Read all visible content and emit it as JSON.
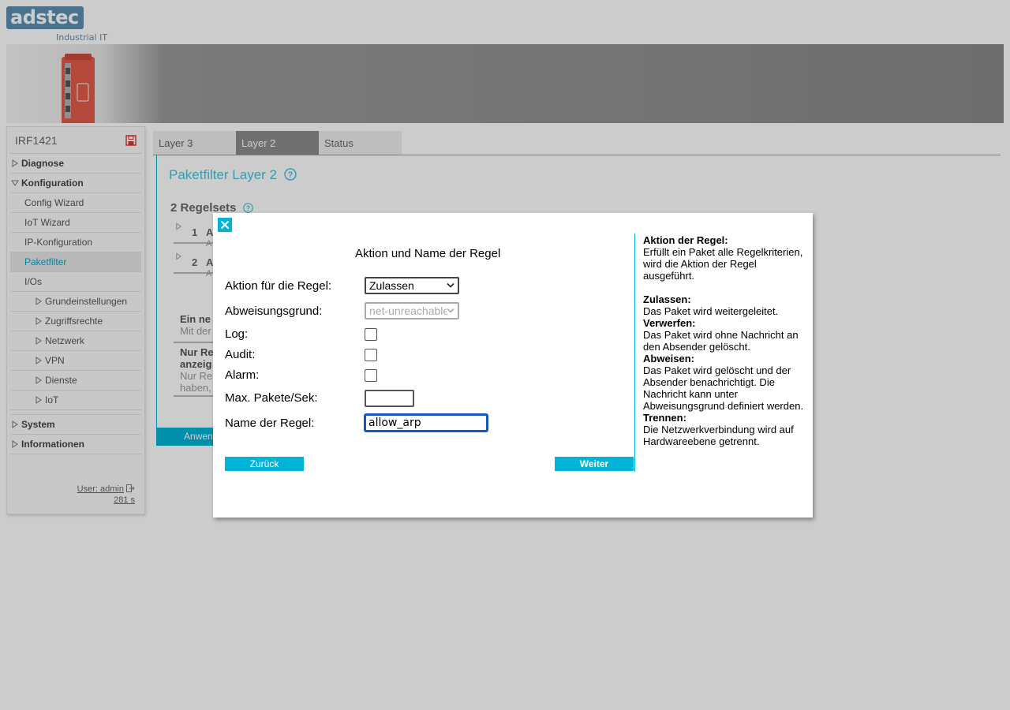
{
  "logo": {
    "brand": "adstec",
    "tagline": "Industrial IT"
  },
  "sidebar": {
    "device_name": "IRF1421",
    "items": [
      {
        "label": "Diagnose",
        "level": "top",
        "expanded": false
      },
      {
        "label": "Konfiguration",
        "level": "top",
        "expanded": true
      },
      {
        "label": "Config Wizard",
        "level": "sub"
      },
      {
        "label": "IoT Wizard",
        "level": "sub"
      },
      {
        "label": "IP-Konfiguration",
        "level": "sub"
      },
      {
        "label": "Paketfilter",
        "level": "sub",
        "active": true
      },
      {
        "label": "I/Os",
        "level": "sub"
      },
      {
        "label": "Grundeinstellungen",
        "level": "subsub"
      },
      {
        "label": "Zugriffsrechte",
        "level": "subsub"
      },
      {
        "label": "Netzwerk",
        "level": "subsub"
      },
      {
        "label": "VPN",
        "level": "subsub"
      },
      {
        "label": "Dienste",
        "level": "subsub"
      },
      {
        "label": "IoT",
        "level": "subsub"
      },
      {
        "label": "System",
        "level": "top",
        "expanded": false
      },
      {
        "label": "Informationen",
        "level": "top",
        "expanded": false
      }
    ],
    "user_label": "User: admin",
    "session_timer": "281 s"
  },
  "tabs": [
    {
      "label": "Layer 3",
      "active": false
    },
    {
      "label": "Layer 2",
      "active": true
    },
    {
      "label": "Status",
      "active": false
    }
  ],
  "page": {
    "title": "Paketfilter Layer 2",
    "rulesets_title": "2 Regelsets",
    "rulesets": [
      {
        "num": "1",
        "letter": "A",
        "sub": "A"
      },
      {
        "num": "2",
        "letter": "A",
        "sub": "A"
      }
    ],
    "info1_bold": "Ein ne",
    "info1_text": "Mit der",
    "info2_bold_1": "Nur Re",
    "info2_bold_2": "anzeig",
    "info2_text_1": "Nur Re",
    "info2_text_2": "haben,",
    "apply_label": "Anwen"
  },
  "dialog": {
    "heading": "Aktion und Name der Regel",
    "action_label": "Aktion für die Regel:",
    "action_value": "Zulassen",
    "reject_reason_label": "Abweisungsgrund:",
    "reject_reason_value": "net-unreachable",
    "log_label": "Log:",
    "audit_label": "Audit:",
    "alarm_label": "Alarm:",
    "max_packets_label": "Max. Pakete/Sek:",
    "max_packets_value": "",
    "rule_name_label": "Name der Regel:",
    "rule_name_value": "allow_arp",
    "back_label": "Zurück",
    "next_label": "Weiter"
  },
  "help": {
    "title": "Aktion der Regel:",
    "intro": "Erfüllt ein Paket alle Regelkriterien, wird die Aktion der Regel ausgeführt.",
    "allow_title": "Zulassen:",
    "allow_text": "Das Paket wird weitergeleitet.",
    "drop_title": "Verwerfen:",
    "drop_text": "Das Paket wird ohne Nachricht an den Absender gelöscht.",
    "reject_title": "Abweisen:",
    "reject_text": "Das Paket wird gelöscht und der Absender benachrichtigt. Die Nachricht kann unter Abweisungsgrund definiert werden.",
    "disconnect_title": "Trennen:",
    "disconnect_text": "Die Netzwerkverbindung wird auf Hardwareebene getrennt."
  },
  "colors": {
    "accent": "#00b4d8",
    "logo_blue": "#5d8fb1",
    "focus_blue": "#1457c0"
  }
}
